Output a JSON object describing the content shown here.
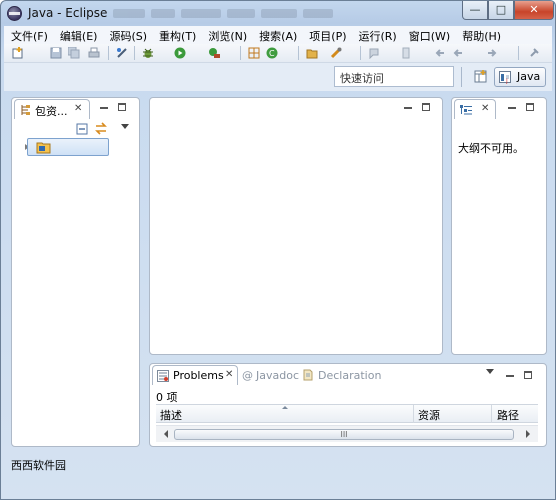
{
  "window": {
    "title": "Java - Eclipse",
    "minimize": "—",
    "maximize": "□",
    "close": "✕"
  },
  "menu": [
    "文件(F)",
    "编辑(E)",
    "源码(S)",
    "重构(T)",
    "浏览(N)",
    "搜索(A)",
    "项目(P)",
    "运行(R)",
    "窗口(W)",
    "帮助(H)"
  ],
  "toolbar": {
    "quick_access": "快速访问",
    "perspective": "Java",
    "icons": [
      "new-icon",
      "save-icon",
      "save-all-icon",
      "print-icon",
      "toggle-breadpoint-icon",
      "debug-icon",
      "run-icon",
      "external-tools-icon",
      "new-java-project-icon",
      "new-package-icon",
      "new-class-icon",
      "open-type-icon",
      "search-icon",
      "annotation-icon",
      "back-icon",
      "forward-icon",
      "pin-icon",
      "open-perspective-icon"
    ]
  },
  "package_explorer": {
    "tab_label": "包资...",
    "close": "✕"
  },
  "outline": {
    "tab_label": "",
    "close": "✕",
    "message": "大纲不可用。"
  },
  "bottom": {
    "tabs": [
      {
        "label": "Problems",
        "active": true
      },
      {
        "label": "Javadoc",
        "active": false
      },
      {
        "label": "Declaration",
        "active": false
      }
    ],
    "count": "0 项",
    "columns": [
      "描述",
      "资源",
      "路径"
    ],
    "scroll_grip": "III"
  },
  "status_text": "西西软件园",
  "colors": {
    "accent": "#3a6ea5",
    "close_red": "#c8442a",
    "frame": "#c3d7ee"
  }
}
